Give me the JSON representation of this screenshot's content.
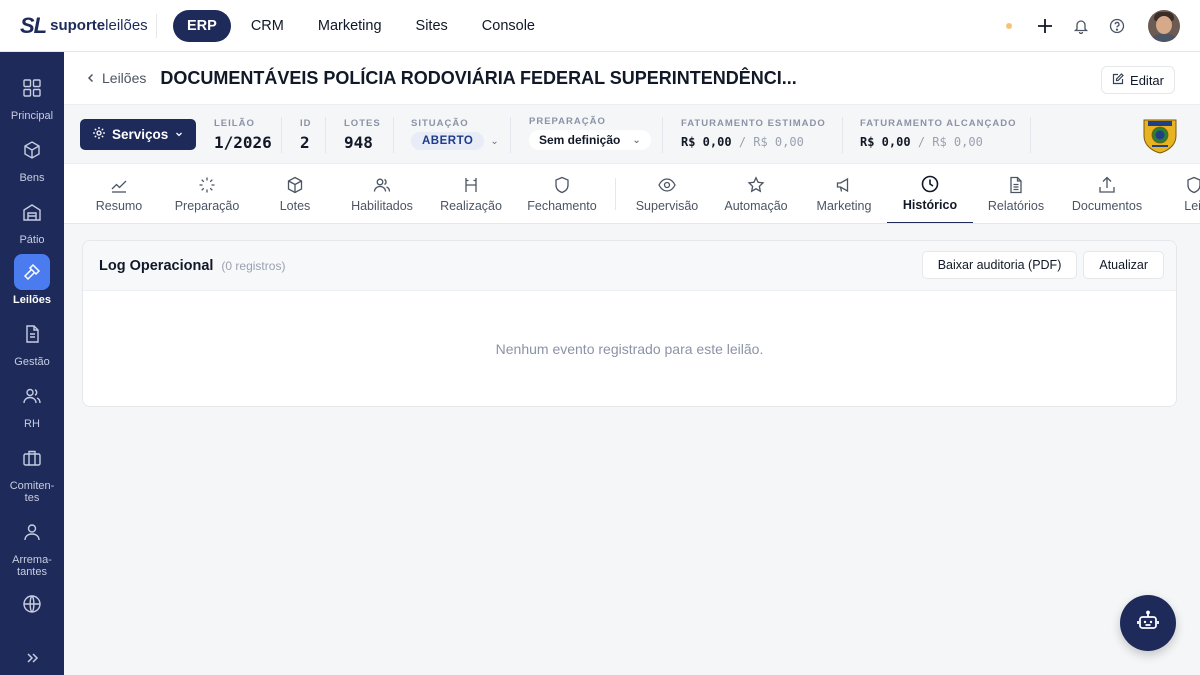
{
  "brand": {
    "mark": "SL",
    "name_bold": "suporte",
    "name_light": "leilões"
  },
  "topnav": {
    "items": [
      "ERP",
      "CRM",
      "Marketing",
      "Sites",
      "Console"
    ],
    "active": "ERP"
  },
  "sidebar": {
    "items": [
      {
        "label": "Principal",
        "icon": "grid-icon"
      },
      {
        "label": "Bens",
        "icon": "box-icon"
      },
      {
        "label": "Pátio",
        "icon": "warehouse-icon"
      },
      {
        "label": "Leilões",
        "icon": "gavel-icon"
      },
      {
        "label": "Gestão",
        "icon": "document-icon"
      },
      {
        "label": "RH",
        "icon": "users-icon"
      },
      {
        "label": "Comiten-tes",
        "icon": "briefcase-icon"
      },
      {
        "label": "Arrema-tantes",
        "icon": "user-icon"
      },
      {
        "label": "",
        "icon": "globe-icon"
      }
    ],
    "active": "Leilões"
  },
  "header": {
    "back_label": "Leilões",
    "title": "DOCUMENTÁVEIS POLÍCIA RODOVIÁRIA FEDERAL SUPERINTENDÊNCI...",
    "edit_label": "Editar"
  },
  "stats": {
    "services_label": "Serviços",
    "leilao": {
      "label": "LEILÃO",
      "value": "1/2026"
    },
    "id": {
      "label": "ID",
      "value": "2"
    },
    "lotes": {
      "label": "LOTES",
      "value": "948"
    },
    "situacao": {
      "label": "SITUAÇÃO",
      "value": "ABERTO"
    },
    "preparacao": {
      "label": "PREPARAÇÃO",
      "value": "Sem definição"
    },
    "fat_estimado": {
      "label": "FATURAMENTO ESTIMADO",
      "value": "R$ 0,00",
      "sub": "/ R$ 0,00"
    },
    "fat_alcancado": {
      "label": "FATURAMENTO ALCANÇADO",
      "value": "R$ 0,00",
      "sub": "/ R$ 0,00"
    }
  },
  "tabs": {
    "items": [
      "Resumo",
      "Preparação",
      "Lotes",
      "Habilitados",
      "Realização",
      "Fechamento",
      "Supervisão",
      "Automação",
      "Marketing",
      "Histórico",
      "Relatórios",
      "Documentos",
      "Leil"
    ],
    "active": "Histórico"
  },
  "log": {
    "title": "Log Operacional",
    "count": "(0 registros)",
    "download_label": "Baixar auditoria (PDF)",
    "refresh_label": "Atualizar",
    "empty_message": "Nenhum evento registrado para este leilão."
  },
  "colors": {
    "primary": "#1e2a5a",
    "accent": "#4a7cf0",
    "status_dot": "#f6c27a"
  }
}
